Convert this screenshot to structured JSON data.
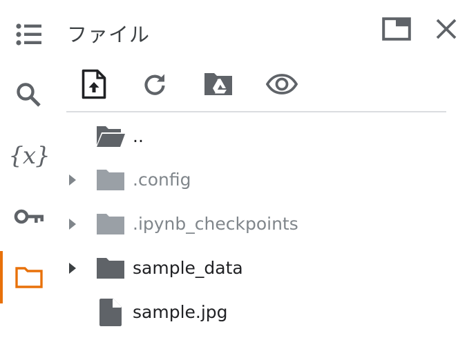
{
  "rail": {
    "items": [
      {
        "name": "table-of-contents",
        "icon": "list-icon"
      },
      {
        "name": "search",
        "icon": "search-icon"
      },
      {
        "name": "variables",
        "icon": "variables-icon",
        "glyph": "{x}"
      },
      {
        "name": "secrets",
        "icon": "key-icon"
      },
      {
        "name": "files",
        "icon": "folder-outline-icon",
        "active": true
      }
    ],
    "active_color": "#e8710a"
  },
  "panel": {
    "title": "ファイル",
    "header_icons": [
      "open-in-new-panel-icon",
      "close-icon"
    ]
  },
  "toolbar": {
    "buttons": [
      {
        "name": "upload",
        "icon": "upload-file-icon"
      },
      {
        "name": "refresh",
        "icon": "refresh-icon"
      },
      {
        "name": "mount-drive",
        "icon": "google-drive-folder-icon"
      },
      {
        "name": "show-hidden",
        "icon": "eye-icon"
      }
    ]
  },
  "files": [
    {
      "name": "..",
      "type": "parent-folder",
      "icon": "folder-open-icon",
      "expandable": false,
      "hidden": false
    },
    {
      "name": ".config",
      "type": "folder",
      "icon": "folder-icon",
      "expandable": true,
      "hidden": true
    },
    {
      "name": ".ipynb_checkpoints",
      "type": "folder",
      "icon": "folder-icon",
      "expandable": true,
      "hidden": true
    },
    {
      "name": "sample_data",
      "type": "folder",
      "icon": "folder-icon",
      "expandable": true,
      "hidden": false
    },
    {
      "name": "sample.jpg",
      "type": "file",
      "icon": "file-icon",
      "expandable": false,
      "hidden": false
    }
  ],
  "colors": {
    "icon_gray": "#5f6368",
    "hidden_gray": "#9aa0a6",
    "text_dark": "#202124",
    "text_dim": "#80868b",
    "divider": "#dadce0"
  }
}
